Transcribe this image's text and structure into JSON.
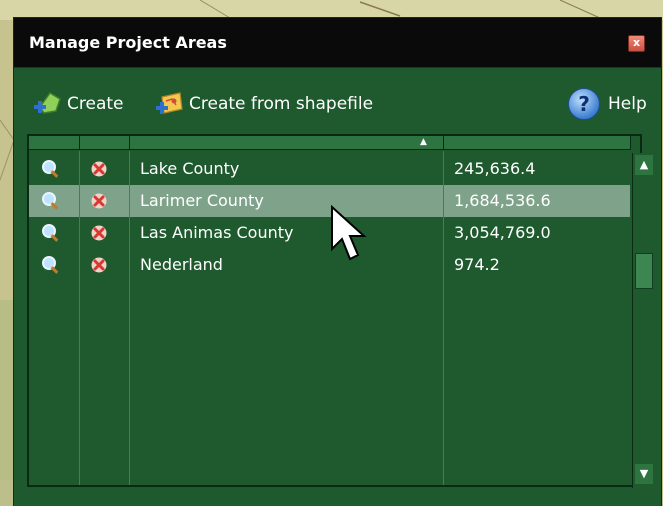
{
  "dialog": {
    "title": "Manage Project Areas",
    "close_label": "x"
  },
  "toolbar": {
    "create_label": "Create",
    "create_from_shapefile_label": "Create from shapefile",
    "help_label": "Help",
    "help_glyph": "?"
  },
  "table": {
    "sort_indicator": "▲",
    "rows": [
      {
        "name": "Lake County",
        "area": "245,636.4",
        "selected": false
      },
      {
        "name": "Larimer County",
        "area": "1,684,536.6",
        "selected": true
      },
      {
        "name": "Las Animas County",
        "area": "3,054,769.0",
        "selected": false
      },
      {
        "name": "Nederland",
        "area": "974.2",
        "selected": false
      }
    ]
  },
  "scrollbar": {
    "up_glyph": "▲",
    "down_glyph": "▼"
  },
  "colors": {
    "panel": "#1e5a2e",
    "titlebar": "#0a0a0a",
    "selected_row": "#7fa38a",
    "delete_red": "#d63a2e"
  }
}
